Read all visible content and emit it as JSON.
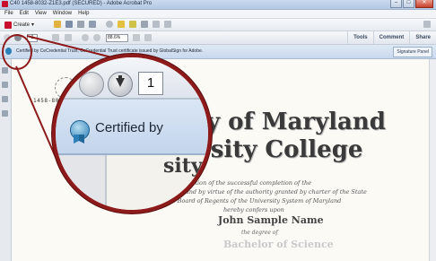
{
  "window": {
    "title": "C40 1458-8032-Z1E3.pdf (SECURED) - Adobe Acrobat Pro",
    "min": "–",
    "max": "□",
    "close": "✕"
  },
  "menu": [
    "File",
    "Edit",
    "View",
    "Window",
    "Help"
  ],
  "toolbar": {
    "create_label": "Create",
    "page_value": "1",
    "zoom": "88.6%",
    "tools": "Tools",
    "comment": "Comment",
    "share": "Share"
  },
  "certificate_bar": {
    "message": "Certified by CeCredential Trust, CeCredential Trust certificate issued by GlobalSign for Adobe.",
    "signature_panel": "Signature Panel"
  },
  "document": {
    "serial": "1458-8032-Z",
    "line1": "ty of Maryland",
    "line2": "rsity College",
    "italic1": "ognition of the successful completion of the",
    "italic2": "ly and by virtue of the authority granted by charter of the State",
    "italic3": "the Board of Regents of the University System of Maryland",
    "italic4": "hereby confers upon",
    "name": "John Sample Name",
    "degree_of": "the degree of",
    "degree": "Bachelor of Science"
  },
  "magnifier": {
    "page_value": "1",
    "certified_text": "Certified by",
    "gothic": "sity"
  },
  "colors": {
    "lens_border": "#8d1b1b",
    "cert_bar": "#c8d8ec"
  }
}
